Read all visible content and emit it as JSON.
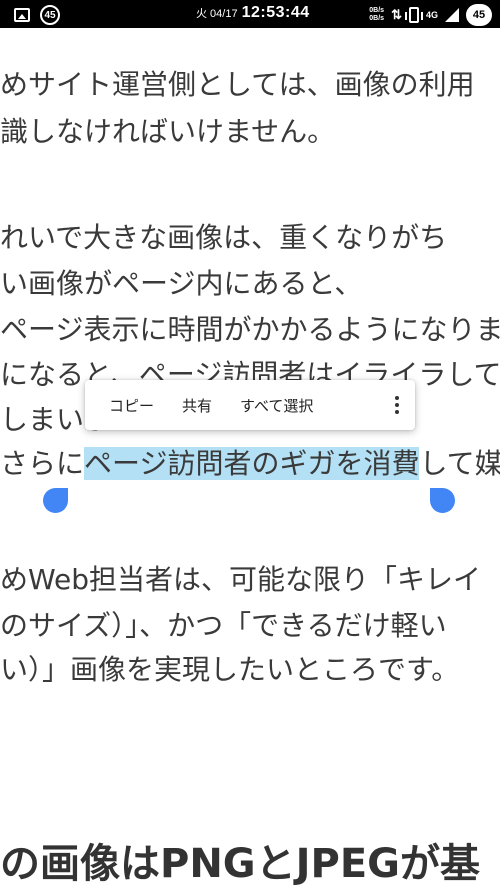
{
  "status_bar": {
    "left_badge": "45",
    "date": "火 04/17",
    "time": "12:53:44",
    "speed_up": "0B/s",
    "speed_down": "0B/s",
    "network": "4G",
    "battery": "45"
  },
  "article": {
    "lines": [
      "めサイト運営側としては、画像の利用",
      "識しなければいけません。",
      "れいで大きな画像は、重くなりがち",
      "い画像がページ内にあると、",
      "ページ表示に時間がかかるようになりま",
      "になると、ページ訪問者はイライラして",
      "しまいま",
      "さらに",
      "ページ訪問者のギガを消費",
      "して媒",
      "めWeb担当者は、可能な限り「キレイ",
      "のサイズ）」、かつ「できるだけ軽い",
      "い）」画像を実現したいところです。"
    ],
    "heading": "の画像はPNGとJPEGが基"
  },
  "selection_toolbar": {
    "copy": "コピー",
    "share": "共有",
    "select_all": "すべて選択"
  },
  "colors": {
    "selection": "#b3e0f5",
    "handle": "#4285f4"
  }
}
